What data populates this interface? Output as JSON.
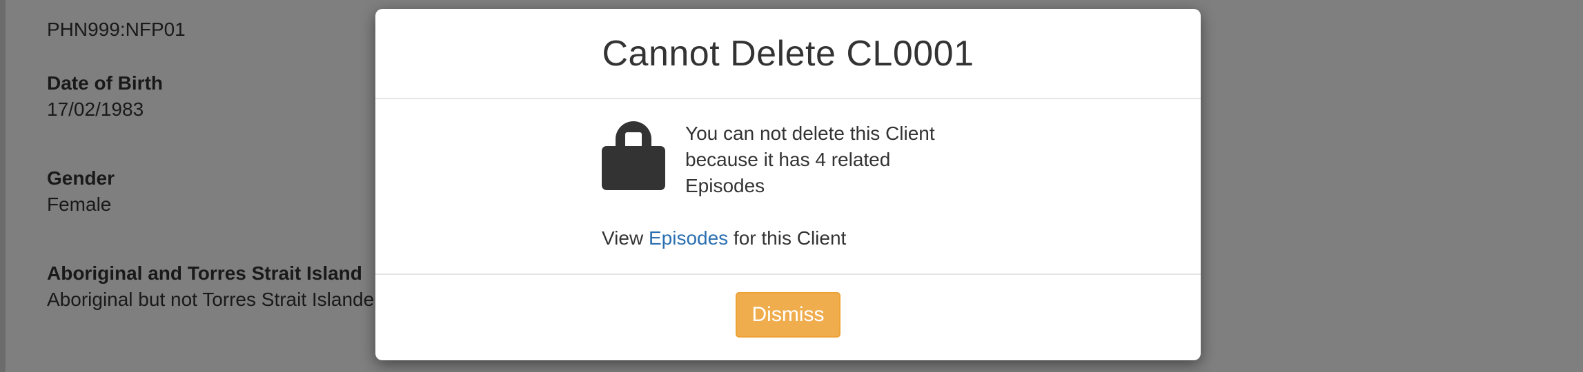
{
  "background": {
    "fields": [
      {
        "label": "",
        "value": "PHN999:NFP01"
      },
      {
        "label": "Date of Birth",
        "value": "17/02/1983"
      },
      {
        "label": "Gender",
        "value": "Female"
      },
      {
        "label": "Aboriginal and Torres Strait Island",
        "value": "Aboriginal but not Torres Strait Islande"
      }
    ]
  },
  "modal": {
    "title": "Cannot Delete CL0001",
    "icon": "lock-icon",
    "message": "You can not delete this Client because it has 4 related Episodes",
    "view_prefix": "View ",
    "view_link": "Episodes",
    "view_suffix": " for this Client",
    "dismiss_label": "Dismiss"
  },
  "colors": {
    "link": "#2a6fb0",
    "button": "#f0ad4e",
    "button_border": "#eea236",
    "backdrop": "rgba(0,0,0,0.5)",
    "icon": "#333333"
  }
}
